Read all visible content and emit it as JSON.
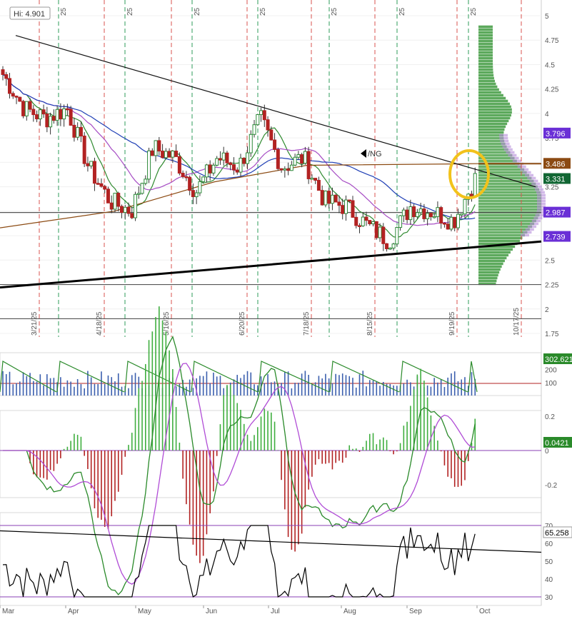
{
  "chart_data": {
    "type": "candlestick",
    "symbol": "/NG",
    "high_note": "Hi: 4.901",
    "y_ticks": [
      "5",
      "4.75",
      "4.5",
      "4.25",
      "4",
      "3.75",
      "3.5",
      "3.25",
      "3",
      "2.75",
      "2.5",
      "2.25",
      "2",
      "1.75"
    ],
    "ylim": [
      1.7,
      5.1
    ],
    "x_months": [
      "Mar",
      "Apr",
      "May",
      "Jun",
      "Jul",
      "Aug",
      "Sep",
      "Oct"
    ],
    "expiry_dates": [
      "3/21/25",
      "4/18/25",
      "5/16/25",
      "6/20/25",
      "7/18/25",
      "8/15/25",
      "9/19/25",
      "10/17/25"
    ],
    "green_line_labels": [
      "25",
      "25",
      "25",
      "25",
      "25",
      "25",
      "25"
    ],
    "price_badges": [
      {
        "value": "3.796",
        "color": "#6a2fd6"
      },
      {
        "value": "3.486",
        "color": "#8b4a12"
      },
      {
        "value": "3.331",
        "color": "#116633"
      },
      {
        "value": "2.987",
        "color": "#6a2fd6"
      },
      {
        "value": "2.739",
        "color": "#6a2fd6"
      }
    ],
    "horizontal_levels": [
      2.987,
      2.25,
      1.9
    ],
    "ohlc_weekly_approx": [
      {
        "date": "Mar",
        "close": 4.4
      },
      {
        "date": "Mar-2",
        "close": 4.05
      },
      {
        "date": "Mar-3",
        "close": 3.95
      },
      {
        "date": "Apr",
        "close": 4.05
      },
      {
        "date": "Apr-2",
        "close": 3.45
      },
      {
        "date": "Apr-3",
        "close": 3.1
      },
      {
        "date": "Apr-4",
        "close": 3.0
      },
      {
        "date": "May",
        "close": 3.65
      },
      {
        "date": "May-2",
        "close": 3.55
      },
      {
        "date": "May-3",
        "close": 3.2
      },
      {
        "date": "Jun",
        "close": 3.55
      },
      {
        "date": "Jun-2",
        "close": 3.45
      },
      {
        "date": "Jun-3",
        "close": 3.95
      },
      {
        "date": "Jul",
        "close": 3.45
      },
      {
        "date": "Jul-2",
        "close": 3.55
      },
      {
        "date": "Jul-3",
        "close": 3.1
      },
      {
        "date": "Aug",
        "close": 3.05
      },
      {
        "date": "Aug-2",
        "close": 2.85
      },
      {
        "date": "Aug-3",
        "close": 2.7
      },
      {
        "date": "Sep",
        "close": 3.05
      },
      {
        "date": "Sep-2",
        "close": 3.0
      },
      {
        "date": "Sep-3",
        "close": 2.9
      },
      {
        "date": "Sep-4",
        "close": 3.33
      }
    ],
    "volume_panel": {
      "ticks": [
        "200",
        "100"
      ],
      "badge": "302.621"
    },
    "macd_panel": {
      "ticks": [
        "0.2",
        "0",
        "-0.2"
      ],
      "badge": "0.0421"
    },
    "rsi_panel": {
      "ticks": [
        "70",
        "60",
        "50",
        "40",
        "30"
      ],
      "badge": "65.258"
    },
    "colors": {
      "up": "#2e8b3a",
      "down": "#b22222",
      "trend": "#000000",
      "ma_blue": "#1f3fb5",
      "ma_brown": "#8b4a12",
      "ma_purple": "#a64cc4",
      "ma_green": "#2f8a2f",
      "volume_profile": "#4aa04a",
      "volume_profile_purple": "#b48bd8",
      "highlight_circle": "#f2c21b"
    }
  }
}
